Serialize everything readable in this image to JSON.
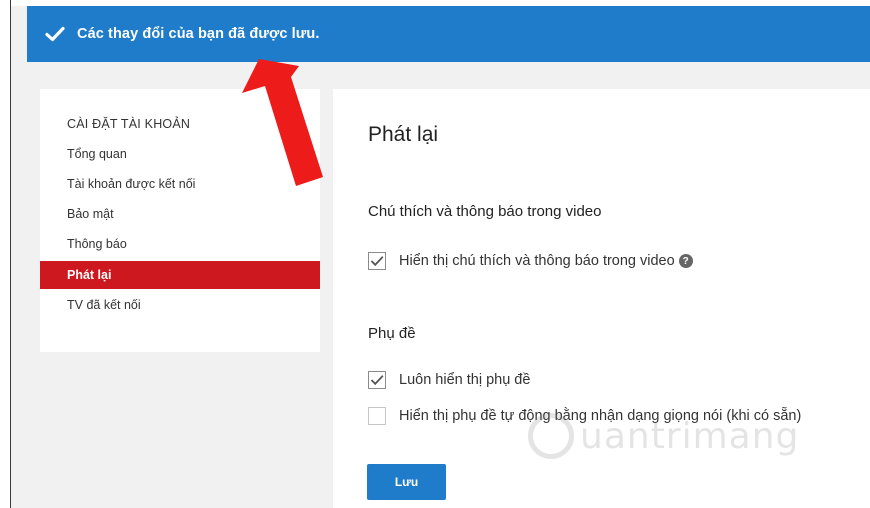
{
  "banner": {
    "message": "Các thay đổi của bạn đã được lưu.",
    "icon": "checkmark-icon",
    "color": "#1f7ccb"
  },
  "sidebar": {
    "heading": "CÀI ĐẶT TÀI KHOẢN",
    "items": [
      {
        "label": "Tổng quan",
        "active": false
      },
      {
        "label": "Tài khoản được kết nối",
        "active": false
      },
      {
        "label": "Bảo mật",
        "active": false
      },
      {
        "label": "Thông báo",
        "active": false
      },
      {
        "label": "Phát lại",
        "active": true
      },
      {
        "label": "TV đã kết nối",
        "active": false
      }
    ],
    "active_color": "#cc181e"
  },
  "main": {
    "title": "Phát lại",
    "sections": [
      {
        "heading": "Chú thích và thông báo trong video",
        "options": [
          {
            "label": "Hiển thị chú thích và thông báo trong video",
            "checked": true,
            "help_icon": "question-circle-icon"
          }
        ]
      },
      {
        "heading": "Phụ đề",
        "options": [
          {
            "label": "Luôn hiển thị phụ đề",
            "checked": true
          },
          {
            "label": "Hiển thị phụ đề tự động bằng nhận dạng giọng nói (khi có sẵn)",
            "checked": false
          }
        ]
      }
    ],
    "save_label": "Lưu"
  },
  "annotation": {
    "arrow_color": "#ee1b1b",
    "icon": "red-arrow-icon"
  },
  "watermark": {
    "text": "uantrimang"
  }
}
